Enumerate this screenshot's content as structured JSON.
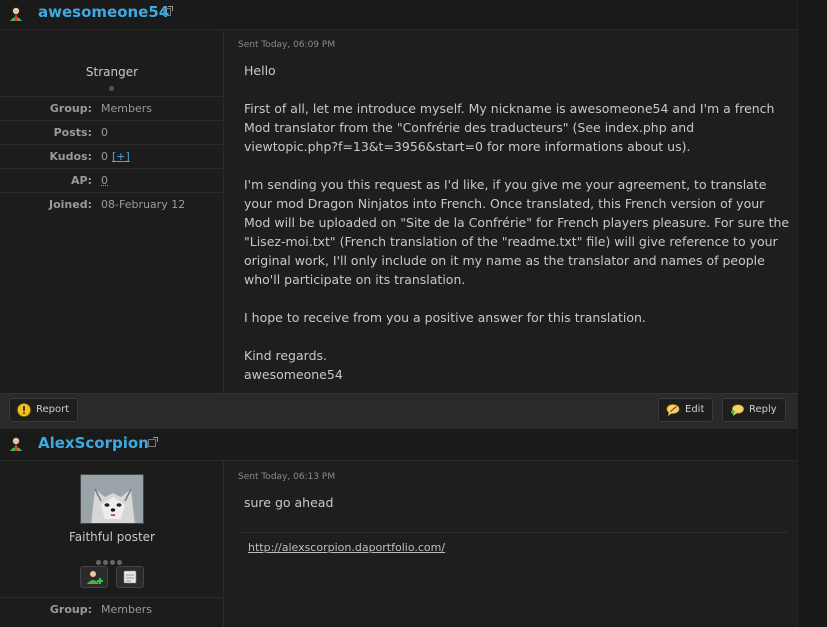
{
  "posts": [
    {
      "username": "awesomeone54",
      "rank": "Stranger",
      "info": {
        "group_label": "Group:",
        "group_value": "Members",
        "posts_label": "Posts:",
        "posts_value": "0",
        "kudos_label": "Kudos:",
        "kudos_value": "0",
        "kudos_link": "[+]",
        "ap_label": "AP:",
        "ap_value": "0",
        "joined_label": "Joined:",
        "joined_value": "08-February 12"
      },
      "sent": "Sent Today, 06:09 PM",
      "message": [
        "Hello",
        "First of all, let me introduce myself. My nickname is awesomeone54 and I'm a french Mod translator from the \"Confrérie des traducteurs\" (See index.php and viewtopic.php?f=13&t=3956&start=0 for more informations about us).",
        "I'm sending you this request as I'd like, if you give me your agreement, to translate your mod Dragon Ninjatos into French. Once translated, this French version of your Mod will be uploaded on \"Site de la Confrérie\" for French players pleasure. For sure the \"Lisez-moi.txt\" (French translation of the \"readme.txt\" file) will give reference to your original work, I'll only include on it my name as the translator and names of people who'll participate on its translation.",
        "I hope to receive from you a positive answer for this translation.",
        "Kind regards.",
        "awesomeone54"
      ],
      "actions": {
        "report": "Report",
        "edit": "Edit",
        "reply": "Reply"
      }
    },
    {
      "username": "AlexScorpion",
      "rank": "Faithful poster",
      "info": {
        "group_label": "Group:",
        "group_value": "Members"
      },
      "sent": "Sent Today, 06:13 PM",
      "message": [
        "sure go ahead"
      ],
      "signature_link": "http://alexscorpion.daportfolio.com/"
    }
  ],
  "colors": {
    "username": "#3fa9e0",
    "background": "#1e1e1e",
    "text": "#c8c8c8"
  },
  "icons": [
    "user-icon",
    "external-link-icon",
    "warning-icon",
    "edit-bubble-icon",
    "reply-bubble-icon",
    "add-friend-icon",
    "send-message-icon"
  ]
}
